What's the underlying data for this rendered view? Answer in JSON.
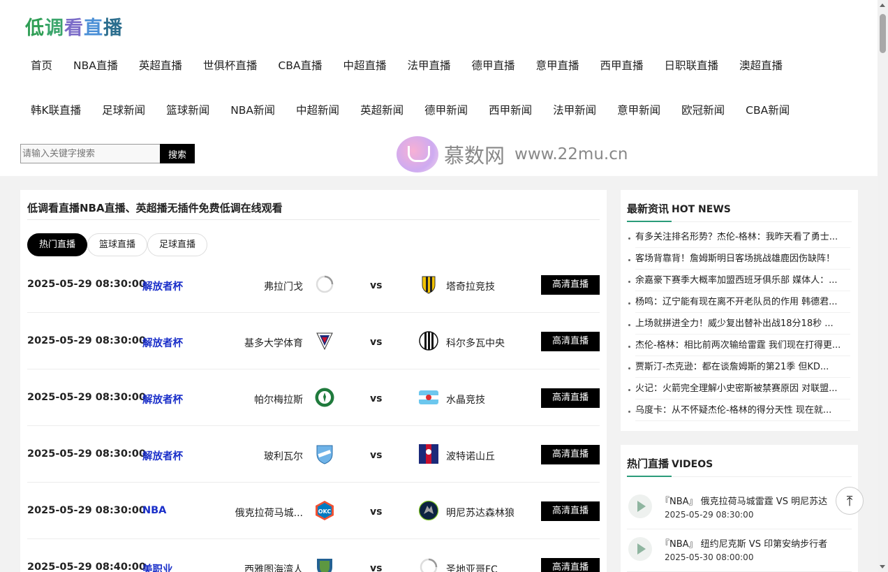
{
  "logo": {
    "chars": [
      "低",
      "调",
      "看",
      "直",
      "播"
    ]
  },
  "nav": {
    "row1": [
      "首页",
      "NBA直播",
      "英超直播",
      "世俱杯直播",
      "CBA直播",
      "中超直播",
      "法甲直播",
      "德甲直播",
      "意甲直播",
      "西甲直播",
      "日职联直播",
      "澳超直播"
    ],
    "row2": [
      "韩K联直播",
      "足球新闻",
      "篮球新闻",
      "NBA新闻",
      "中超新闻",
      "英超新闻",
      "德甲新闻",
      "西甲新闻",
      "法甲新闻",
      "意甲新闻",
      "欧冠新闻",
      "CBA新闻"
    ]
  },
  "search": {
    "placeholder": "请输入关键字搜索",
    "button": "搜索"
  },
  "watermark": {
    "text": "慕数网",
    "url": "www.22mu.cn"
  },
  "main": {
    "title": "低调看直播NBA直播、英超播无插件免费低调在线观看",
    "tabs": [
      "热门直播",
      "篮球直播",
      "足球直播"
    ],
    "matches": [
      {
        "time": "2025-05-29 08:30:00",
        "league": "解放者杯",
        "home": "弗拉门戈",
        "away": "塔奇拉竞技",
        "button": "高清直播",
        "home_logo": "spinner-icon",
        "away_logo": "tachira-crest-icon"
      },
      {
        "time": "2025-05-29 08:30:00",
        "league": "解放者杯",
        "home": "基多大学体育",
        "away": "科尔多瓦中央",
        "button": "高清直播",
        "home_logo": "ldu-crest-icon",
        "away_logo": "central-cordoba-crest-icon"
      },
      {
        "time": "2025-05-29 08:30:00",
        "league": "解放者杯",
        "home": "帕尔梅拉斯",
        "away": "水晶竞技",
        "button": "高清直播",
        "home_logo": "palmeiras-crest-icon",
        "away_logo": "cristal-crest-icon"
      },
      {
        "time": "2025-05-29 08:30:00",
        "league": "解放者杯",
        "home": "玻利瓦尔",
        "away": "波特诺山丘",
        "button": "高清直播",
        "home_logo": "bolivar-crest-icon",
        "away_logo": "cerro-crest-icon"
      },
      {
        "time": "2025-05-29 08:30:00",
        "league": "NBA",
        "home": "俄克拉荷马城...",
        "away": "明尼苏达森林狼",
        "button": "高清直播",
        "home_logo": "okc-logo-icon",
        "away_logo": "wolves-logo-icon"
      },
      {
        "time": "2025-05-29 08:40:00",
        "league": "美职业",
        "home": "西雅图海湾人",
        "away": "圣地亚哥FC",
        "button": "高清直播",
        "home_logo": "seattle-crest-icon",
        "away_logo": "spinner-icon"
      }
    ]
  },
  "news": {
    "title": "最新资讯",
    "title_en": "HOT NEWS",
    "items": [
      "有多关注排名形势？杰伦-格林：我昨天看了勇士...",
      "客场背靠背！詹姆斯明日客场挑战雄鹿因伤缺阵！",
      "余嘉豪下赛季大概率加盟西班牙俱乐部 媒体人：...",
      "杨鸣：辽宁能有现在离不开老队员的作用 韩德君...",
      "上场就拼进全力！威少复出替补出战18分18秒 ...",
      "杰伦-格林：相比前两次输给雷霆 我们现在打得更...",
      "贾斯汀-杰克逊：都在谈詹姆斯的第21季 但KD...",
      "火记：火箭完全理解小史密斯被禁赛原因 对联盟...",
      "乌度卡：从不怀疑杰伦-格林的得分天性 现在就..."
    ]
  },
  "videos": {
    "title": "热门直播",
    "title_en": "VIDEOS",
    "items": [
      {
        "title": "『NBA』 俄克拉荷马城雷霆 VS 明尼苏达",
        "date": "2025-05-29 08:30:00"
      },
      {
        "title": "『NBA』 纽约尼克斯 VS 印第安纳步行者",
        "date": "2025-05-30 08:00:00"
      }
    ]
  },
  "back_top": {
    "symbol": "⤒"
  },
  "colors": {
    "accent": "#2b9c7a",
    "league_link": "#1a2fc9",
    "button_bg": "#000000"
  }
}
